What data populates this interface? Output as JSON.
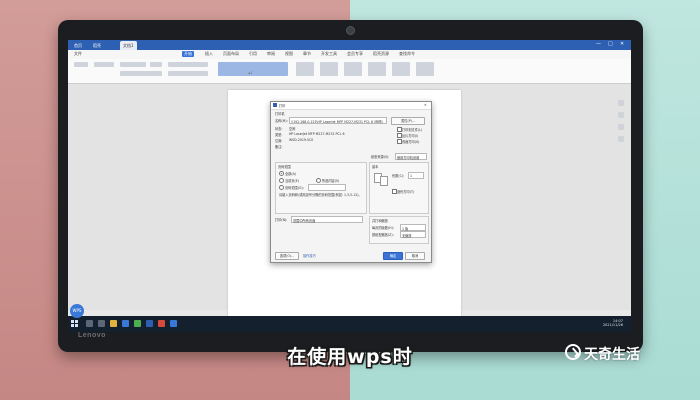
{
  "caption": "在使用wps时",
  "watermark": "天奇生活",
  "laptop": {
    "brand": "Lenovo"
  },
  "wps": {
    "tabs": [
      {
        "label": "首页"
      },
      {
        "label": "稻壳"
      },
      {
        "label": "文档1"
      }
    ],
    "window_controls": [
      "—",
      "□",
      "✕"
    ],
    "menu": [
      "文件",
      "开始",
      "插入",
      "页面布局",
      "引用",
      "审阅",
      "视图",
      "章节",
      "开发工具",
      "会员专享",
      "稻壳资源",
      "查找命令"
    ],
    "active_menu": "开始",
    "zoom": "100%"
  },
  "print_dialog": {
    "title": "打印",
    "printer_section": "打印机",
    "name_label": "名称(M):",
    "name_value": "\\\\192.168.0.125\\HP LaserJet MFP M227-M231 PCL 6 (网络)",
    "properties_button": "属性(P)...",
    "status_label": "状态:",
    "status_value": "空闲",
    "type_label": "类型:",
    "type_value": "HP LaserJet MFP M227-M231 PCL 6",
    "where_label": "位置:",
    "where_value": "WSD-2019-5C0",
    "comment_label": "备注:",
    "print_to_file": "打印到文件(L)",
    "reverse_order": "反片打印(I)",
    "duplex": "双面打印(X)",
    "paper_source_label": "纸张来源(S):",
    "paper_source_value": "使用打印机设置",
    "page_range": "页码范围",
    "all": "全部(A)",
    "current_page": "当前页(E)",
    "selection": "所选内容(S)",
    "pages": "页码范围(G):",
    "pages_hint": "请键入页码和/或用逗号分隔的页码范围(例如: 1,3,5-12)。",
    "copies_group": "副本",
    "copies_label": "份数(C):",
    "copies_value": "1",
    "collate": "逐份打印(T)",
    "print_what_label": "打印(N):",
    "print_what_value": "范围中所有页面",
    "zoom_group": "并打和缩放",
    "pages_per_sheet_label": "每页的版数(H):",
    "pages_per_sheet_value": "1 版",
    "scale_label": "按纸型缩放(Z):",
    "scale_value": "无缩放",
    "options_button": "选项(O)...",
    "tips": "操作技巧",
    "ok_button": "确定",
    "cancel_button": "取消"
  },
  "taskbar": {
    "time": "14:07",
    "date": "2021/11/26"
  },
  "wps_bubble": "WPS"
}
